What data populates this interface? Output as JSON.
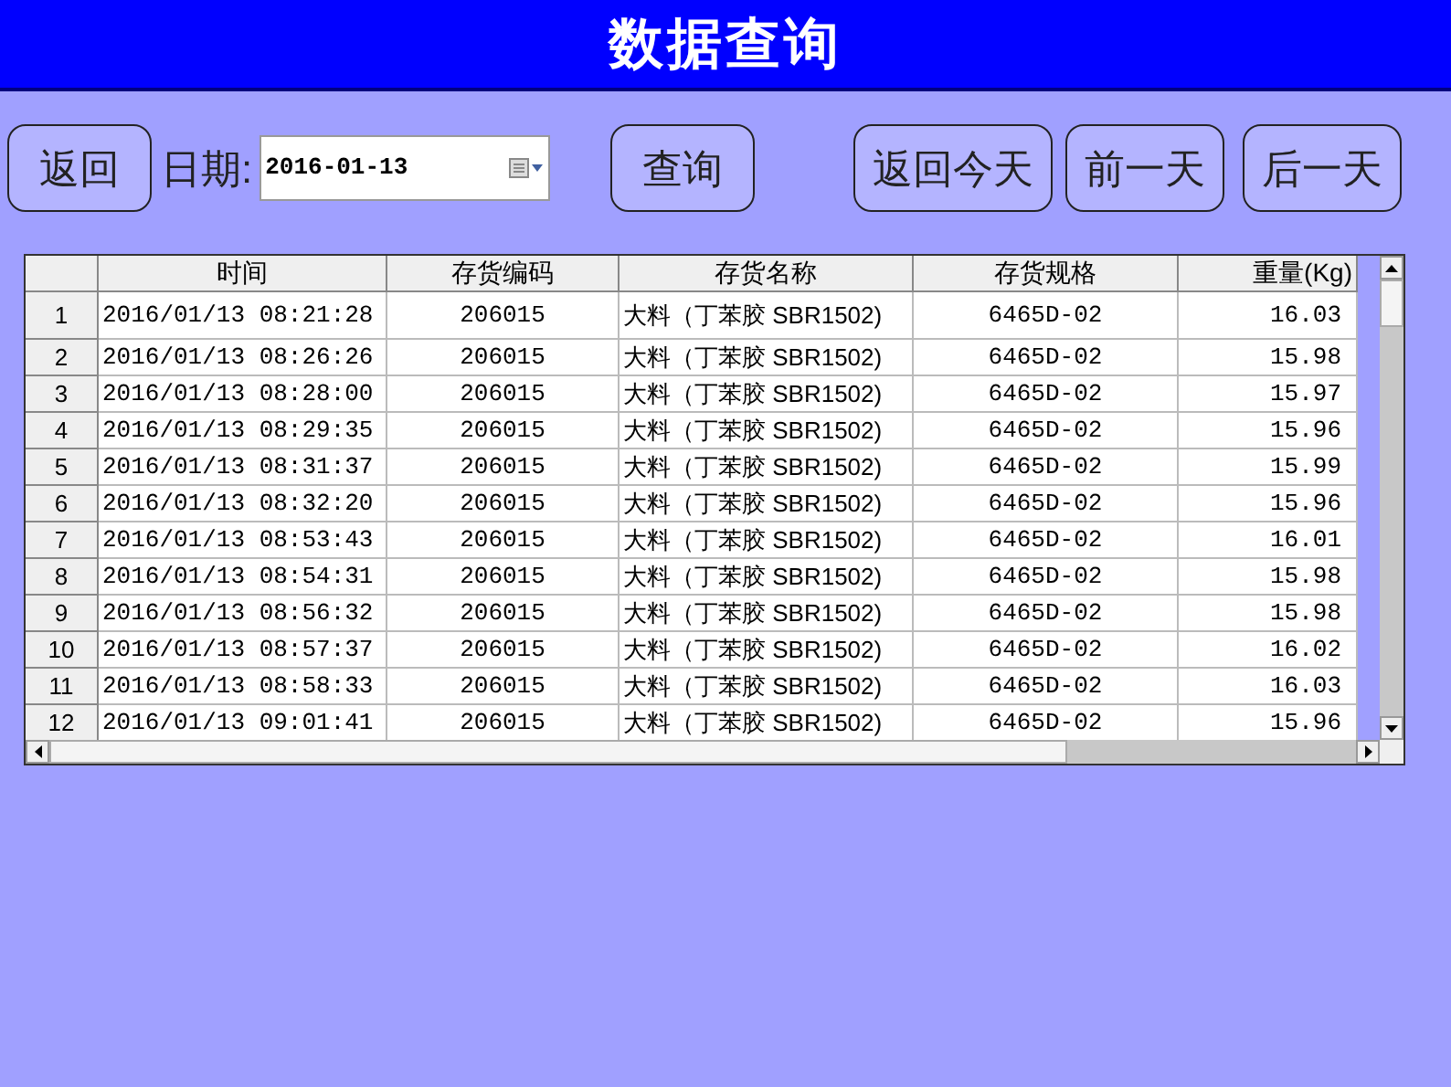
{
  "window": {
    "title": "数据查询"
  },
  "toolbar": {
    "back": "返回",
    "date_label": "日期:",
    "date_value": "2016-01-13",
    "query": "查询",
    "today": "返回今天",
    "prev_day": "前一天",
    "next_day": "后一天"
  },
  "table": {
    "columns": [
      "时间",
      "存货编码",
      "存货名称",
      "存货规格",
      "重量(Kg)"
    ],
    "rows": [
      {
        "index": "1",
        "cells": [
          "2016/01/13 08:21:28",
          "206015",
          "大料（丁苯胶 SBR1502)",
          "6465D-02",
          "16.03"
        ]
      },
      {
        "index": "2",
        "cells": [
          "2016/01/13 08:26:26",
          "206015",
          "大料（丁苯胶 SBR1502)",
          "6465D-02",
          "15.98"
        ]
      },
      {
        "index": "3",
        "cells": [
          "2016/01/13 08:28:00",
          "206015",
          "大料（丁苯胶 SBR1502)",
          "6465D-02",
          "15.97"
        ]
      },
      {
        "index": "4",
        "cells": [
          "2016/01/13 08:29:35",
          "206015",
          "大料（丁苯胶 SBR1502)",
          "6465D-02",
          "15.96"
        ]
      },
      {
        "index": "5",
        "cells": [
          "2016/01/13 08:31:37",
          "206015",
          "大料（丁苯胶 SBR1502)",
          "6465D-02",
          "15.99"
        ]
      },
      {
        "index": "6",
        "cells": [
          "2016/01/13 08:32:20",
          "206015",
          "大料（丁苯胶 SBR1502)",
          "6465D-02",
          "15.96"
        ]
      },
      {
        "index": "7",
        "cells": [
          "2016/01/13 08:53:43",
          "206015",
          "大料（丁苯胶 SBR1502)",
          "6465D-02",
          "16.01"
        ]
      },
      {
        "index": "8",
        "cells": [
          "2016/01/13 08:54:31",
          "206015",
          "大料（丁苯胶 SBR1502)",
          "6465D-02",
          "15.98"
        ]
      },
      {
        "index": "9",
        "cells": [
          "2016/01/13 08:56:32",
          "206015",
          "大料（丁苯胶 SBR1502)",
          "6465D-02",
          "15.98"
        ]
      },
      {
        "index": "10",
        "cells": [
          "2016/01/13 08:57:37",
          "206015",
          "大料（丁苯胶 SBR1502)",
          "6465D-02",
          "16.02"
        ]
      },
      {
        "index": "11",
        "cells": [
          "2016/01/13 08:58:33",
          "206015",
          "大料（丁苯胶 SBR1502)",
          "6465D-02",
          "16.03"
        ]
      },
      {
        "index": "12",
        "cells": [
          "2016/01/13 09:01:41",
          "206015",
          "大料（丁苯胶 SBR1502)",
          "6465D-02",
          "15.96"
        ]
      }
    ]
  }
}
